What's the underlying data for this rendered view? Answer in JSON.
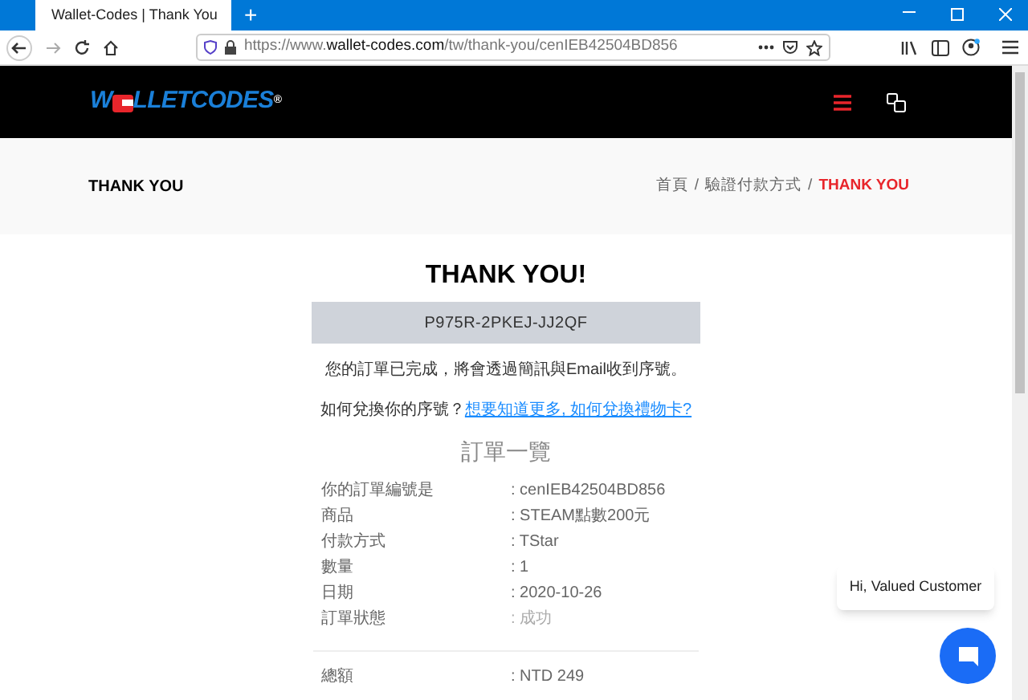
{
  "browser": {
    "tab_title": "Wallet-Codes | Thank You",
    "url_prefix": "https://www.",
    "url_host": "wallet-codes.com",
    "url_path": "/tw/thank-you/cenIEB42504BD856",
    "new_tab": "+"
  },
  "header": {
    "logo": {
      "before": "W",
      "after": "LLETCODES",
      "mark": "®"
    }
  },
  "page_title": {
    "title": "THANK YOU",
    "separator": "/",
    "breadcrumbs": [
      {
        "label": "首頁",
        "current": false
      },
      {
        "label": "驗證付款方式",
        "current": false
      },
      {
        "label": "THANK YOU",
        "current": true
      }
    ]
  },
  "thanks": {
    "heading": "THANK YOU!",
    "code": "P975R-2PKEJ-JJ2QF",
    "message": "您的訂單已完成，將會透過簡訊與Email收到序號。",
    "question": "如何兌換你的序號？",
    "link": "想要知道更多, 如何兌換禮物卡?"
  },
  "summary": {
    "title": "訂單一覽",
    "rows": [
      {
        "label": "你的訂單編號是",
        "value": ": cenIEB42504BD856",
        "muted": false
      },
      {
        "label": "商品",
        "value": ": STEAM點數200元",
        "muted": false
      },
      {
        "label": "付款方式",
        "value": ": TStar",
        "muted": false
      },
      {
        "label": "數量",
        "value": ": 1",
        "muted": false
      },
      {
        "label": "日期",
        "value": ": 2020-10-26",
        "muted": false
      },
      {
        "label": "訂單狀態",
        "value": ": 成功",
        "muted": true
      }
    ],
    "total": {
      "label": "總額",
      "value": ": NTD 249"
    }
  },
  "chat": {
    "greeting": "Hi, Valued Customer"
  }
}
